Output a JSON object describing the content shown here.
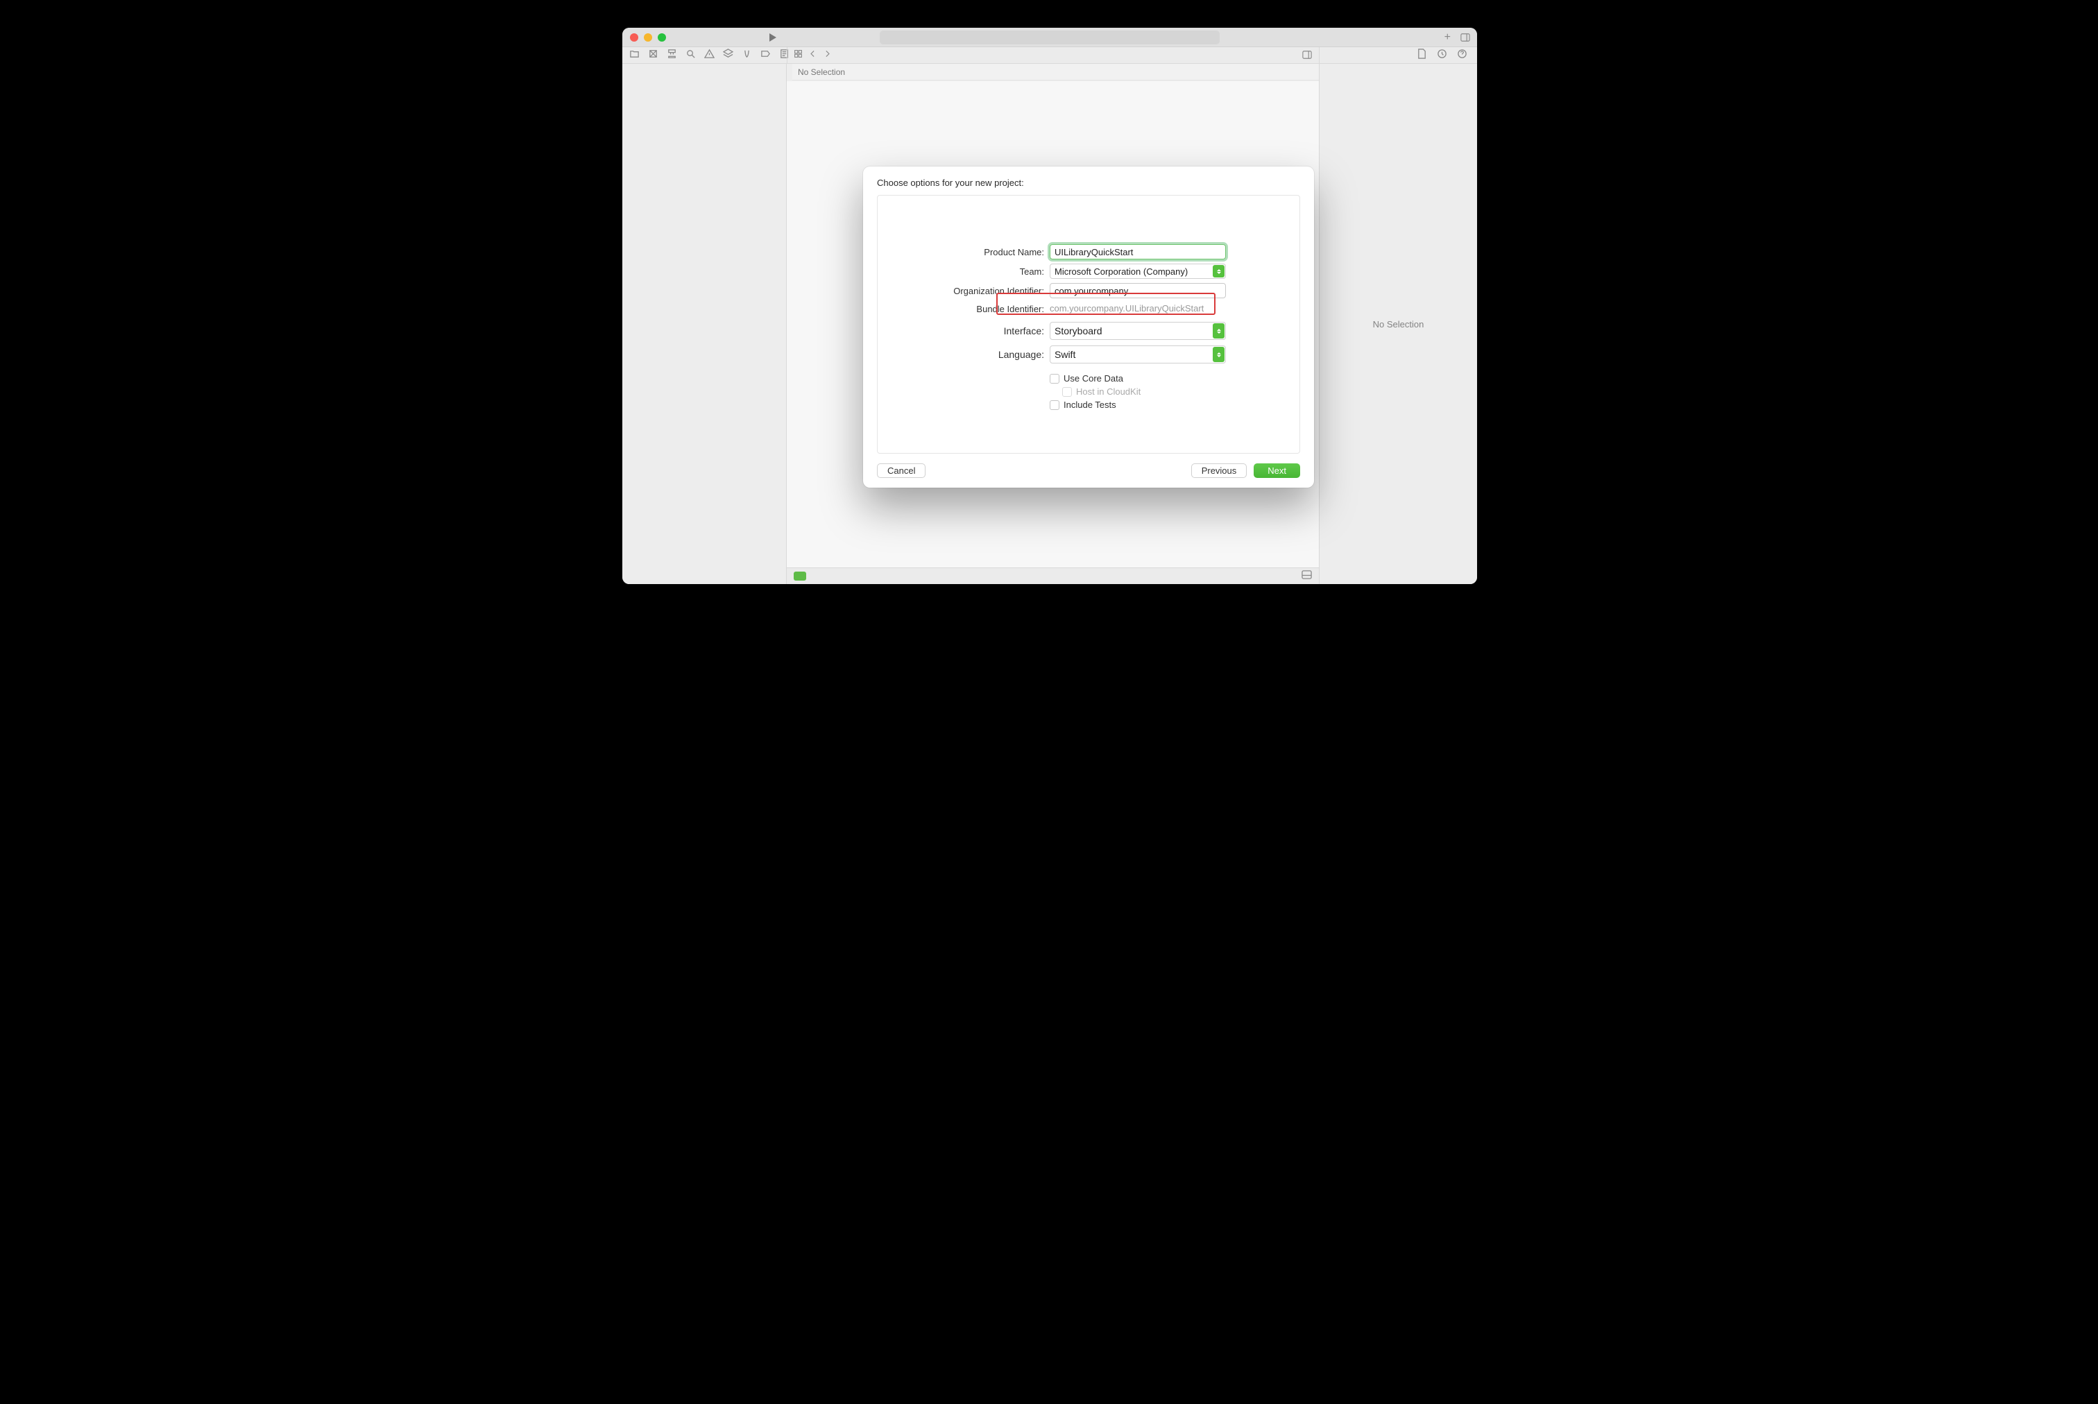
{
  "editor": {
    "no_selection_left": "No Selection",
    "no_selection_right": "No Selection"
  },
  "sheet": {
    "title": "Choose options for your new project:",
    "labels": {
      "product_name": "Product Name:",
      "team": "Team:",
      "org_id": "Organization Identifier:",
      "bundle_id": "Bundle Identifier:",
      "interface": "Interface:",
      "language": "Language:"
    },
    "values": {
      "product_name": "UILibraryQuickStart",
      "team": "Microsoft Corporation (Company)",
      "org_id": "com.yourcompany",
      "bundle_id": "com.yourcompany.UILibraryQuickStart",
      "interface": "Storyboard",
      "language": "Swift"
    },
    "checks": {
      "core_data": "Use Core Data",
      "cloudkit": "Host in CloudKit",
      "tests": "Include Tests"
    },
    "buttons": {
      "cancel": "Cancel",
      "previous": "Previous",
      "next": "Next"
    }
  }
}
